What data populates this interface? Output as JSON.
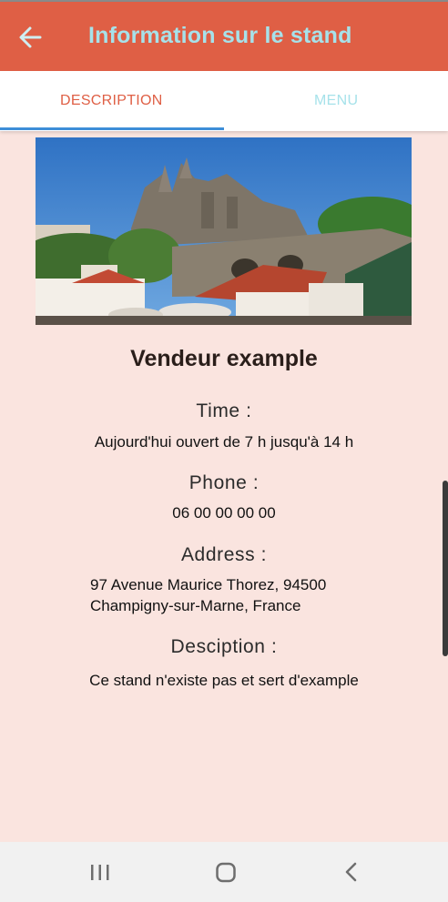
{
  "appbar": {
    "title": "Information sur le stand",
    "back_icon": "arrow-left-icon",
    "background": "#df5f45",
    "title_color": "#a6e2ea"
  },
  "tabs": [
    {
      "label": "DESCRIPTION",
      "active": true,
      "color": "#df5f45"
    },
    {
      "label": "MENU",
      "active": false,
      "color": "#a6e2ea"
    }
  ],
  "tab_indicator_color": "#3d8ed8",
  "stand": {
    "vendor_name": "Vendeur example",
    "time_label": "Time :",
    "time_value": "Aujourd'hui ouvert de  7 h jusqu'à 14 h",
    "phone_label": "Phone :",
    "phone_value": "06 00 00 00 00",
    "address_label": "Address :",
    "address_line1": "97 Avenue Maurice Thorez, 94500",
    "address_line2": "Champigny-sur-Marne, France",
    "description_label": "Desciption :",
    "description_value": "Ce stand n'existe pas et sert d'example"
  },
  "page_background": "#fae4df",
  "navbar": {
    "recent_icon": "recent-apps-icon",
    "home_icon": "home-icon",
    "back_icon": "back-chevron-icon"
  }
}
